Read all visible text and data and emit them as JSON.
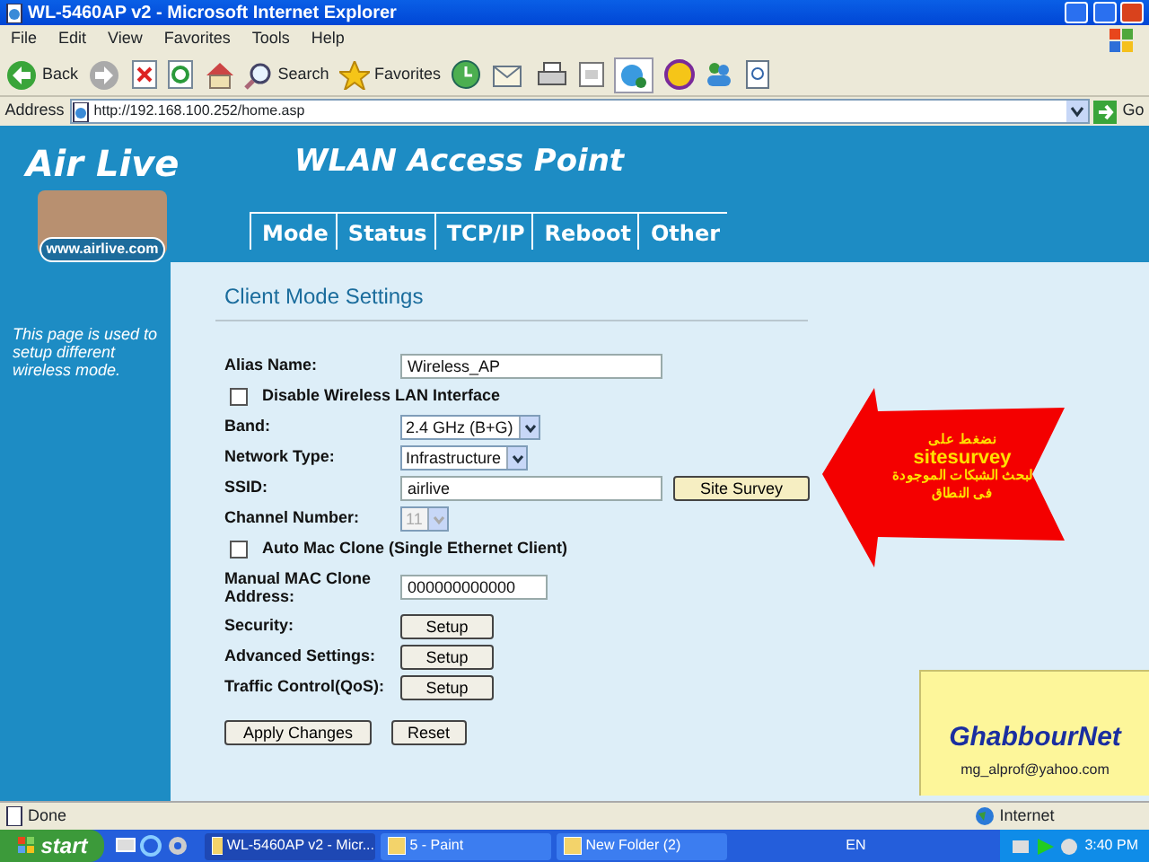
{
  "window": {
    "title": "WL-5460AP v2 - Microsoft Internet Explorer"
  },
  "menu": [
    "File",
    "Edit",
    "View",
    "Favorites",
    "Tools",
    "Help"
  ],
  "toolbar": {
    "back": "Back",
    "search": "Search",
    "favorites": "Favorites"
  },
  "address": {
    "label": "Address",
    "url": "http://192.168.100.252/home.asp",
    "go": "Go"
  },
  "header": {
    "logo": "Air Live",
    "site": "www.airlive.com",
    "title": "WLAN Access Point"
  },
  "tabs": [
    "Mode",
    "Status",
    "TCP/IP",
    "Reboot",
    "Other"
  ],
  "sidebar": {
    "text": "This page is used to setup different wireless mode."
  },
  "form": {
    "heading": "Client Mode Settings",
    "fields": [
      {
        "kind": "text",
        "label": "Alias Name:",
        "value": "Wireless_AP"
      },
      {
        "kind": "checkbox",
        "label": "Disable Wireless LAN Interface",
        "checked": false
      },
      {
        "kind": "select",
        "label": "Band:",
        "value": "2.4 GHz (B+G)",
        "disabled": false
      },
      {
        "kind": "select",
        "label": "Network Type:",
        "value": "Infrastructure",
        "disabled": false
      },
      {
        "kind": "text",
        "label": "SSID:",
        "value": "airlive",
        "button": "Site Survey"
      },
      {
        "kind": "select",
        "label": "Channel Number:",
        "value": "11",
        "disabled": true
      },
      {
        "kind": "checkbox",
        "label": "Auto Mac Clone (Single Ethernet Client)",
        "checked": false
      },
      {
        "kind": "mac",
        "label": "Manual MAC Clone Address:",
        "value": "000000000000"
      },
      {
        "kind": "button",
        "label": "Security:",
        "button": "Setup"
      },
      {
        "kind": "button",
        "label": "Advanced Settings:",
        "button": "Setup"
      },
      {
        "kind": "button",
        "label": "Traffic Control(QoS):",
        "button": "Setup"
      }
    ],
    "actions": [
      "Apply Changes",
      "Reset"
    ]
  },
  "callout": {
    "lines": [
      "نضغط على",
      "sitesurvey",
      "لبحث الشبكات الموجودة",
      "فى النطاق"
    ]
  },
  "note": {
    "title": "GhabbourNet",
    "email": "mg_alprof@yahoo.com"
  },
  "status_bar": {
    "text": "Done",
    "zone": "Internet"
  },
  "taskbar": {
    "start": "start",
    "tasks": [
      {
        "label": "WL-5460AP v2 - Micr...",
        "selected": true
      },
      {
        "label": "5 - Paint",
        "selected": false
      },
      {
        "label": "New Folder (2)",
        "selected": false
      }
    ],
    "language": "EN",
    "time": "3:40 PM"
  }
}
